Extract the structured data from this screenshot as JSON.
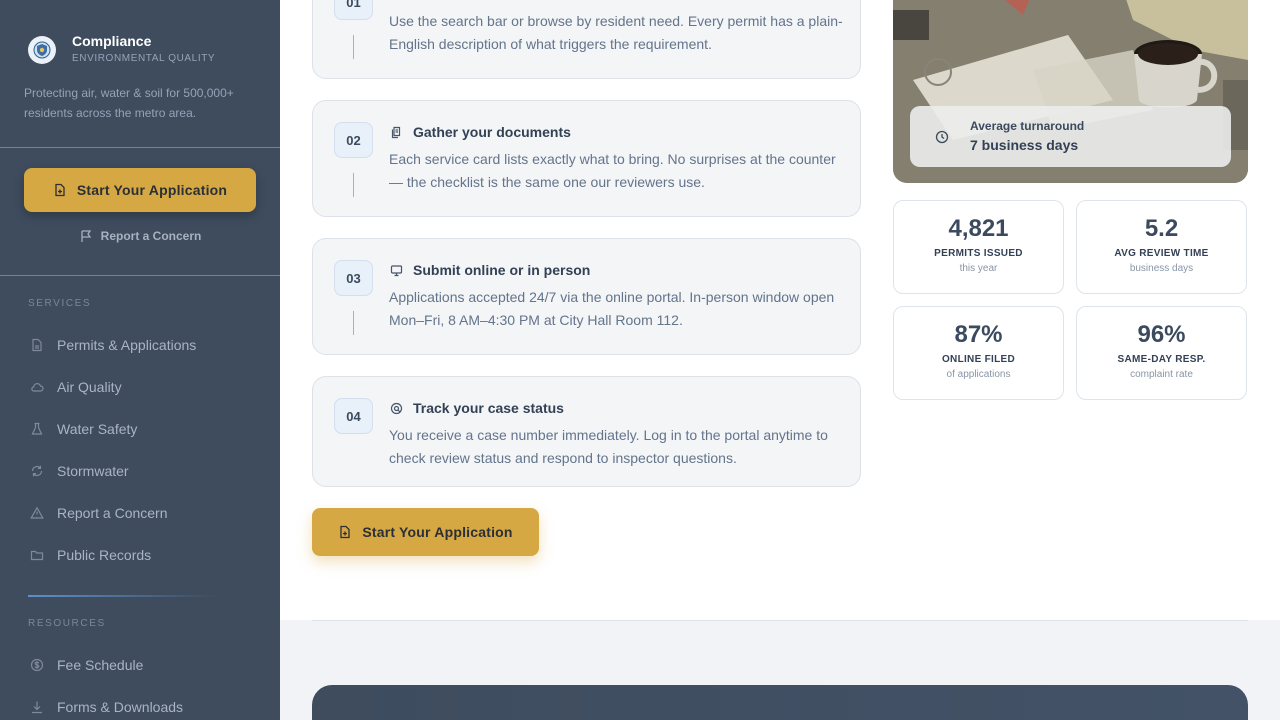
{
  "brand": {
    "title": "Compliance",
    "subtitle": "ENVIRONMENTAL QUALITY",
    "mission": "Protecting air, water & soil for 500,000+ residents across the metro area."
  },
  "sidebar": {
    "cta_label": "Start Your Application",
    "report_label": "Report a Concern",
    "services_label": "SERVICES",
    "services": [
      {
        "label": "Permits & Applications",
        "icon": "document-icon"
      },
      {
        "label": "Air Quality",
        "icon": "cloud-icon"
      },
      {
        "label": "Water Safety",
        "icon": "flask-icon"
      },
      {
        "label": "Stormwater",
        "icon": "refresh-icon"
      },
      {
        "label": "Report a Concern",
        "icon": "warning-icon"
      },
      {
        "label": "Public Records",
        "icon": "folder-icon"
      }
    ],
    "resources_label": "RESOURCES",
    "resources": [
      {
        "label": "Fee Schedule",
        "icon": "dollar-icon"
      },
      {
        "label": "Forms & Downloads",
        "icon": "download-icon"
      }
    ]
  },
  "steps": [
    {
      "num": "01",
      "title": "",
      "desc": "Use the search bar or browse by resident need. Every permit has a plain-English description of what triggers the requirement."
    },
    {
      "num": "02",
      "title": "Gather your documents",
      "desc": "Each service card lists exactly what to bring. No surprises at the counter — the checklist is the same one our reviewers use."
    },
    {
      "num": "03",
      "title": "Submit online or in person",
      "desc": "Applications accepted 24/7 via the online portal. In-person window open Mon–Fri, 8 AM–4:30 PM at City Hall Room 112."
    },
    {
      "num": "04",
      "title": "Track your case status",
      "desc": "You receive a case number immediately. Log in to the portal anytime to check review status and respond to inspector questions."
    }
  ],
  "main_cta": "Start Your Application",
  "turnaround": {
    "label": "Average turnaround",
    "value": "7 business days"
  },
  "stats": [
    {
      "value": "4,821",
      "label": "PERMITS ISSUED",
      "sub": "this year"
    },
    {
      "value": "5.2",
      "label": "AVG REVIEW TIME",
      "sub": "business days"
    },
    {
      "value": "87%",
      "label": "ONLINE FILED",
      "sub": "of applications"
    },
    {
      "value": "96%",
      "label": "SAME-DAY RESP.",
      "sub": "complaint rate"
    }
  ],
  "colors": {
    "sidebar": "#3e4c5e",
    "accent": "#d6a843",
    "step_bg": "#f3f5f7"
  }
}
